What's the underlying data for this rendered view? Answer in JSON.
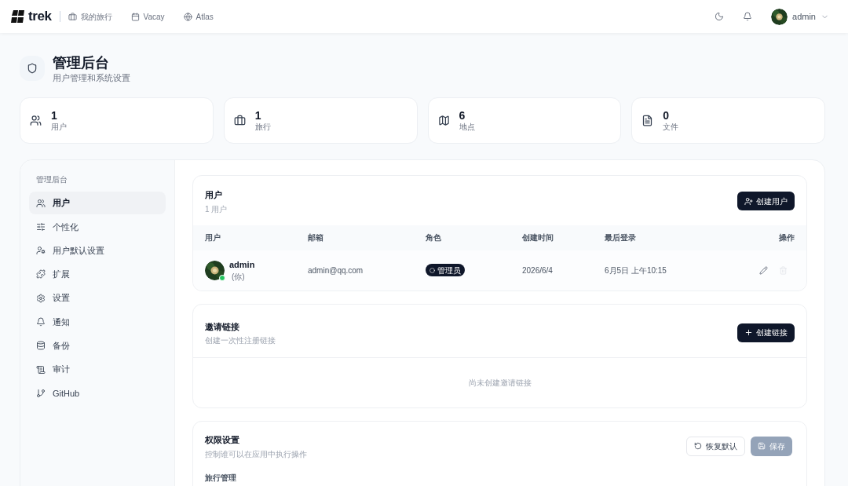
{
  "nav": {
    "brand": "trek",
    "links": [
      {
        "label": "我的旅行"
      },
      {
        "label": "Vacay"
      },
      {
        "label": "Atlas"
      }
    ],
    "user": "admin"
  },
  "header": {
    "title": "管理后台",
    "subtitle": "用户管理和系统设置"
  },
  "stats": [
    {
      "value": "1",
      "label": "用户"
    },
    {
      "value": "1",
      "label": "旅行"
    },
    {
      "value": "6",
      "label": "地点"
    },
    {
      "value": "0",
      "label": "文件"
    }
  ],
  "sidebar": {
    "heading": "管理后台",
    "items": [
      {
        "label": "用户",
        "selected": true
      },
      {
        "label": "个性化",
        "selected": false
      },
      {
        "label": "用户默认设置",
        "selected": false
      },
      {
        "label": "扩展",
        "selected": false
      },
      {
        "label": "设置",
        "selected": false
      },
      {
        "label": "通知",
        "selected": false
      },
      {
        "label": "备份",
        "selected": false
      },
      {
        "label": "审计",
        "selected": false
      },
      {
        "label": "GitHub",
        "selected": false
      }
    ]
  },
  "users": {
    "title": "用户",
    "subtitle": "1 用户",
    "button": "创建用户",
    "columns": [
      "用户",
      "邮箱",
      "角色",
      "创建时间",
      "最后登录",
      "操作"
    ],
    "rows": [
      {
        "name": "admin",
        "you": "(你)",
        "online": true,
        "email": "admin@qq.com",
        "role": "管理员",
        "created": "2026/6/4",
        "last_login": "6月5日 上午10:15"
      }
    ]
  },
  "invites": {
    "title": "邀请链接",
    "subtitle": "创建一次性注册链接",
    "button": "创建链接",
    "empty": "尚未创建邀请链接"
  },
  "permissions": {
    "title": "权限设置",
    "subtitle": "控制谁可以在应用中执行操作",
    "reset": "恢复默认",
    "save": "保存",
    "save_disabled": true,
    "group": "旅行管理"
  }
}
